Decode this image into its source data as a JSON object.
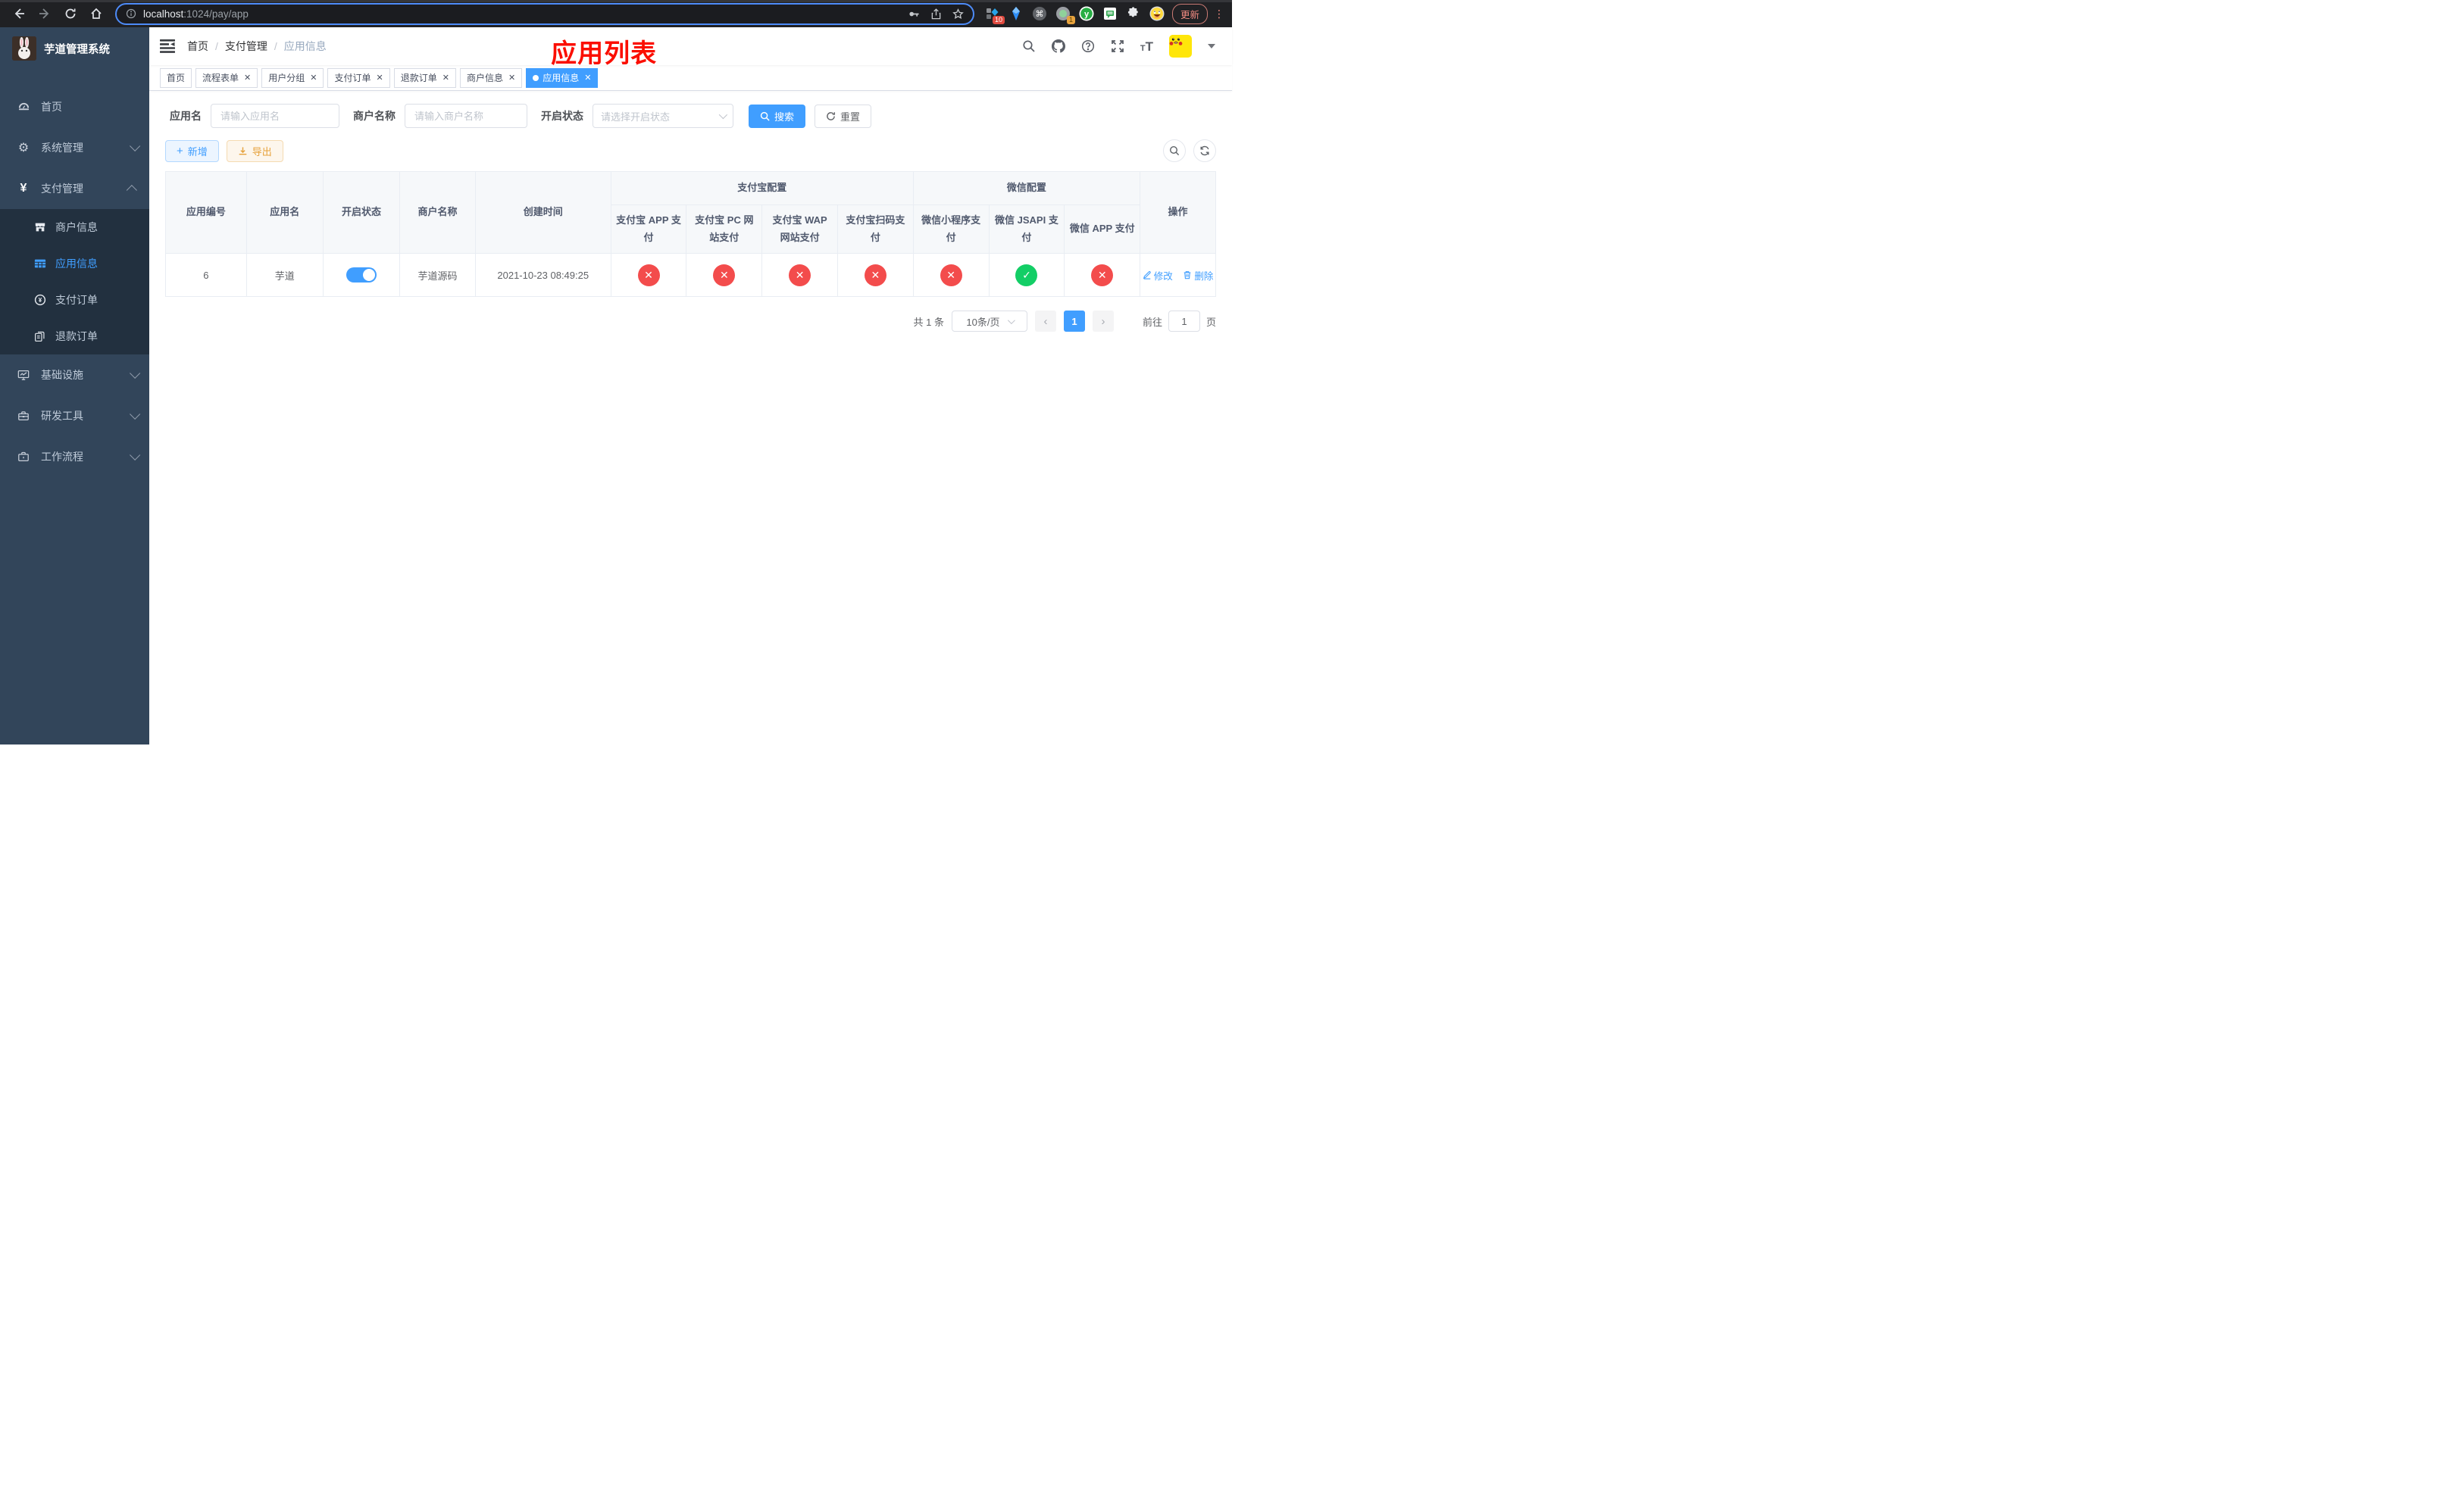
{
  "browser": {
    "url_host": "localhost",
    "url_suffix": ":1024/pay/app",
    "ext_badge_1": "10",
    "ext_badge_2": "1",
    "update_label": "更新"
  },
  "sidebar": {
    "title": "芋道管理系统",
    "menu": [
      {
        "label": "首页"
      },
      {
        "label": "系统管理"
      },
      {
        "label": "支付管理"
      }
    ],
    "submenu": [
      {
        "label": "商户信息"
      },
      {
        "label": "应用信息"
      },
      {
        "label": "支付订单"
      },
      {
        "label": "退款订单"
      }
    ],
    "menu2": [
      {
        "label": "基础设施"
      },
      {
        "label": "研发工具"
      },
      {
        "label": "工作流程"
      }
    ]
  },
  "header": {
    "breadcrumb": [
      "首页",
      "支付管理",
      "应用信息"
    ],
    "annotation": "应用列表"
  },
  "tabs": [
    {
      "label": "首页"
    },
    {
      "label": "流程表单"
    },
    {
      "label": "用户分组"
    },
    {
      "label": "支付订单"
    },
    {
      "label": "退款订单"
    },
    {
      "label": "商户信息"
    },
    {
      "label": "应用信息"
    }
  ],
  "filters": {
    "app_name_label": "应用名",
    "app_name_placeholder": "请输入应用名",
    "merchant_label": "商户名称",
    "merchant_placeholder": "请输入商户名称",
    "status_label": "开启状态",
    "status_placeholder": "请选择开启状态",
    "search_label": "搜索",
    "reset_label": "重置"
  },
  "toolbar": {
    "add_label": "新增",
    "export_label": "导出"
  },
  "table": {
    "columns": [
      "应用编号",
      "应用名",
      "开启状态",
      "商户名称",
      "创建时间"
    ],
    "group_alipay": {
      "label": "支付宝配置",
      "cols": [
        "支付宝 APP 支付",
        "支付宝 PC 网站支付",
        "支付宝 WAP 网站支付",
        "支付宝扫码支付"
      ]
    },
    "group_wechat": {
      "label": "微信配置",
      "cols": [
        "微信小程序支付",
        "微信 JSAPI 支付",
        "微信 APP 支付"
      ]
    },
    "actions_col": "操作",
    "row": {
      "id": "6",
      "name": "芋道",
      "enabled": true,
      "merchant": "芋道源码",
      "created": "2021-10-23 08:49:25",
      "statuses": [
        false,
        false,
        false,
        false,
        false,
        true,
        false
      ],
      "edit_label": "修改",
      "delete_label": "删除"
    }
  },
  "pagination": {
    "total": "共 1 条",
    "page_size": "10条/页",
    "current": "1",
    "goto_label": "前往",
    "goto_value": "1",
    "page_label": "页"
  },
  "colors": {
    "accent": "#409eff",
    "sidebar_bg": "#32455a",
    "submenu_bg": "#22303f",
    "danger": "#f34c4c",
    "success": "#13ce66",
    "warning": "#e6a23c"
  }
}
